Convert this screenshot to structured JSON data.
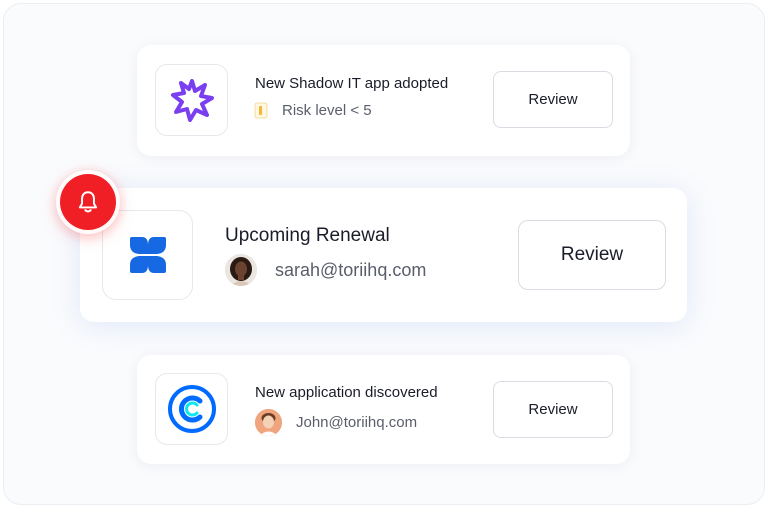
{
  "notifications": [
    {
      "title": "New Shadow IT app adopted",
      "detail": "Risk level < 5",
      "button_label": "Review",
      "app_icon": "purple-starburst-icon",
      "detail_icon": "flag-icon"
    },
    {
      "title": "Upcoming Renewal",
      "detail": "sarah@toriihq.com",
      "button_label": "Review",
      "app_icon": "blue-butterfly-icon",
      "detail_icon": "avatar",
      "alert_icon": "bell-icon"
    },
    {
      "title": "New application discovered",
      "detail": "John@toriihq.com",
      "button_label": "Review",
      "app_icon": "calendly-c-icon",
      "detail_icon": "avatar"
    }
  ],
  "colors": {
    "alert_red": "#f01f25",
    "purple_icon": "#7a3ff0",
    "blue_icon": "#1668e3",
    "calendly_blue": "#006bff"
  }
}
